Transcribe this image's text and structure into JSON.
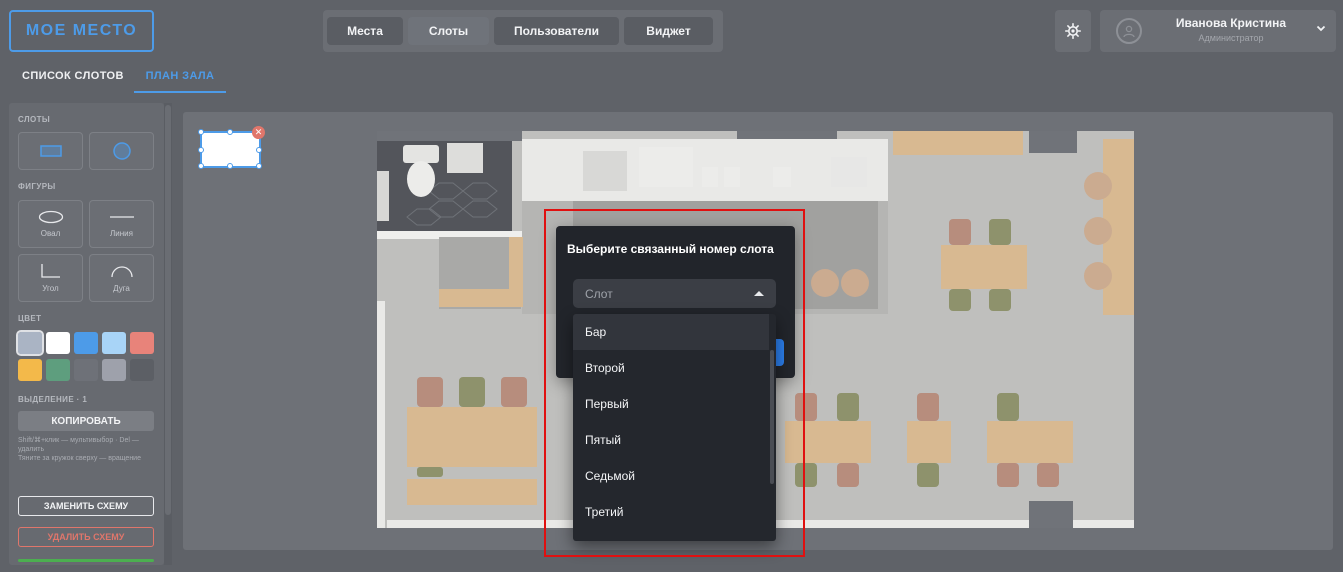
{
  "logo": "МОЕ МЕСТО",
  "nav": {
    "items": [
      {
        "label": "Места",
        "active": false
      },
      {
        "label": "Слоты",
        "active": true
      },
      {
        "label": "Пользователи",
        "active": false
      },
      {
        "label": "Виджет",
        "active": false
      }
    ]
  },
  "settings_icon": "gear-icon",
  "user": {
    "name": "Иванова Кристина",
    "role": "Администратор"
  },
  "subtabs": {
    "list": "СПИСОК СЛОТОВ",
    "plan": "ПЛАН ЗАЛА",
    "active": "plan"
  },
  "panel": {
    "slots_title": "СЛОТЫ",
    "shapes_title": "ФИГУРЫ",
    "shapes": [
      {
        "label": "Овал",
        "icon": "oval-icon"
      },
      {
        "label": "Линия",
        "icon": "line-icon"
      },
      {
        "label": "Угол",
        "icon": "corner-icon"
      },
      {
        "label": "Дуга",
        "icon": "arc-icon"
      }
    ],
    "color_title": "ЦВЕТ",
    "colors": [
      "#aab4c4",
      "#ffffff",
      "#4d9be8",
      "#a8d4f7",
      "#e8837a",
      "#f3b94a",
      "#5e9e7e",
      "#6e7178",
      "#9ea1ab",
      "#5c5f65"
    ],
    "selected_color": "#aab4c4",
    "selection_title": "ВЫДЕЛЕНИЕ · 1",
    "copy_label": "КОПИРОВАТЬ",
    "hint": "Shift/⌘+клик — мультивыбор · Del — удалить\nТяните за кружок сверху — вращение",
    "replace_label": "ЗАМЕНИТЬ СХЕМУ",
    "delete_label": "УДАЛИТЬ СХЕМУ"
  },
  "modal": {
    "title": "Выберите связанный номер слота",
    "select_placeholder": "Слот",
    "options": [
      "Бар",
      "Второй",
      "Первый",
      "Пятый",
      "Седьмой",
      "Третий"
    ],
    "hovered_option": "Бар"
  }
}
